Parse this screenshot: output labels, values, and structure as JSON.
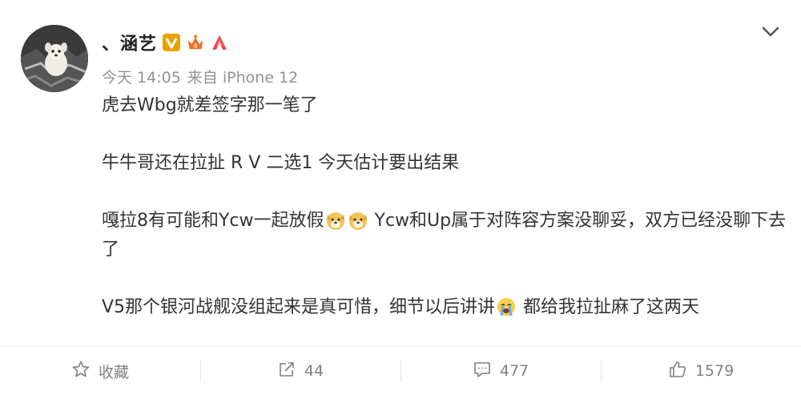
{
  "post": {
    "user_name": "、涵艺",
    "time": "今天 14:05",
    "source": "来自 iPhone 12",
    "paragraphs": {
      "p1": "虎去Wbg就差签字那一笔了",
      "p2": "牛牛哥还在拉扯 R V 二选1 今天估计要出结果",
      "p3a": "嘎拉8有可能和Ycw一起放假",
      "p3b": " Ycw和Up属于对阵容方案没聊妥，双方已经没聊下去了",
      "p4a": "V5那个银河战舰没组起来是真可惜，细节以后讲讲",
      "p4b": " 都给我拉扯麻了这两天"
    },
    "badges": [
      "verified-v-badge",
      "member-crown-badge",
      "fan-badge"
    ]
  },
  "actions": {
    "favorite": "收藏",
    "share_count": "44",
    "comment_count": "477",
    "like_count": "1579"
  },
  "colors": {
    "verified": "#e8a200",
    "member": "#f26d1f",
    "fan": "#f04848",
    "meta_gray": "#939393"
  }
}
